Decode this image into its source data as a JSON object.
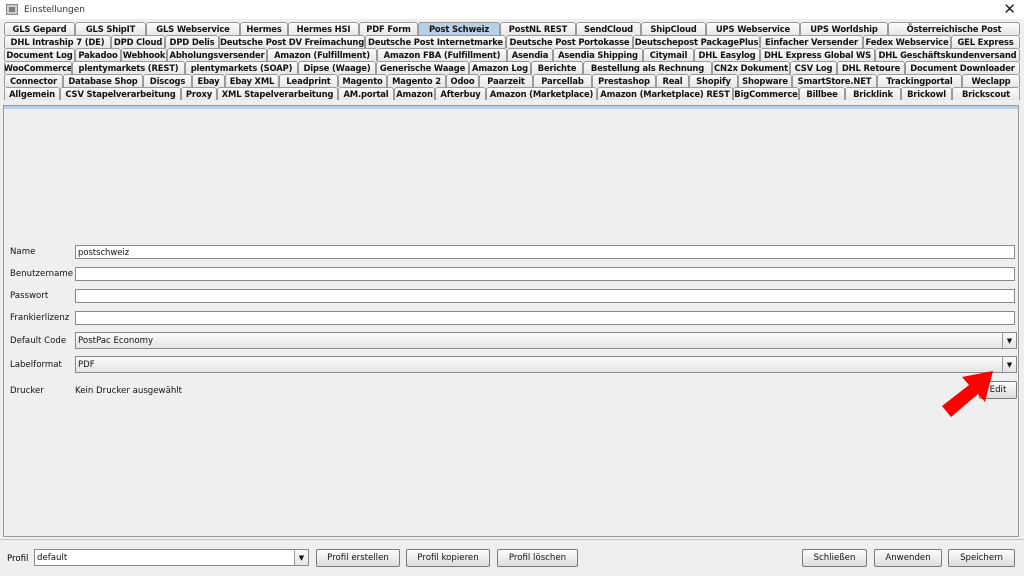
{
  "window": {
    "title": "Einstellungen",
    "close_glyph": "✕",
    "app_icon": "java-cup-icon"
  },
  "tabs": {
    "rows": [
      [
        "GLS Gepard",
        "GLS ShipIT",
        "GLS Webservice",
        "Hermes",
        "Hermes HSI",
        "PDF Form",
        "Post Schweiz",
        "PostNL REST",
        "SendCloud",
        "ShipCloud",
        "UPS Webservice",
        "UPS Worldship",
        "Österreichische Post"
      ],
      [
        "DHL Intraship 7 (DE)",
        "DPD Cloud",
        "DPD Delis",
        "Deutsche Post DV Freimachung",
        "Deutsche Post Internetmarke",
        "Deutsche Post Portokasse",
        "Deutschepost PackagePlus",
        "Einfacher Versender",
        "Fedex Webservice",
        "GEL Express"
      ],
      [
        "Document Log",
        "Pakadoo",
        "Webhook",
        "Abholungsversender",
        "Amazon (Fulfillment)",
        "Amazon FBA (Fulfillment)",
        "Asendia",
        "Asendia Shipping",
        "Citymail",
        "DHL Easylog",
        "DHL Express Global WS",
        "DHL Geschäftskundenversand"
      ],
      [
        "WooCommerce",
        "plentymarkets (REST)",
        "plentymarkets (SOAP)",
        "Dipse (Waage)",
        "Generische Waage",
        "Amazon Log",
        "Berichte",
        "Bestellung als Rechnung",
        "CN2x Dokument",
        "CSV Log",
        "DHL Retoure",
        "Document Downloader"
      ],
      [
        "Connector",
        "Database Shop",
        "Discogs",
        "Ebay",
        "Ebay XML",
        "Leadprint",
        "Magento",
        "Magento 2",
        "Odoo",
        "Paarzeit",
        "Parcellab",
        "Prestashop",
        "Real",
        "Shopify",
        "Shopware",
        "SmartStore.NET",
        "Trackingportal",
        "Weclapp"
      ],
      [
        "Allgemein",
        "CSV Stapelverarbeitung",
        "Proxy",
        "XML Stapelverarbeitung",
        "AM.portal",
        "Amazon",
        "Afterbuy",
        "Amazon (Marketplace)",
        "Amazon (Marketplace) REST",
        "BigCommerce",
        "Billbee",
        "Bricklink",
        "Brickowl",
        "Brickscout"
      ]
    ],
    "selected": "Post Schweiz",
    "selected_color": "#b8cfe5"
  },
  "form": {
    "name": {
      "label": "Name",
      "value": "postschweiz"
    },
    "benutzername": {
      "label": "Benutzername",
      "value": ""
    },
    "passwort": {
      "label": "Passwort",
      "value": ""
    },
    "frankierlizenz": {
      "label": "Frankierlizenz",
      "value": ""
    },
    "default_code": {
      "label": "Default Code",
      "value": "PostPac Economy"
    },
    "labelformat": {
      "label": "Labelformat",
      "value": "PDF"
    },
    "drucker": {
      "label": "Drucker",
      "value": "Kein Drucker ausgewählt",
      "edit_label": "Edit"
    }
  },
  "annotation": {
    "color": "#ff0000",
    "icon": "red-arrow-icon"
  },
  "bottom": {
    "profil_label": "Profil",
    "profil_value": "default",
    "buttons": {
      "erstellen": "Profil erstellen",
      "kopieren": "Profil kopieren",
      "loeschen": "Profil löschen",
      "schliessen": "Schließen",
      "anwenden": "Anwenden",
      "speichern": "Speichern"
    }
  }
}
